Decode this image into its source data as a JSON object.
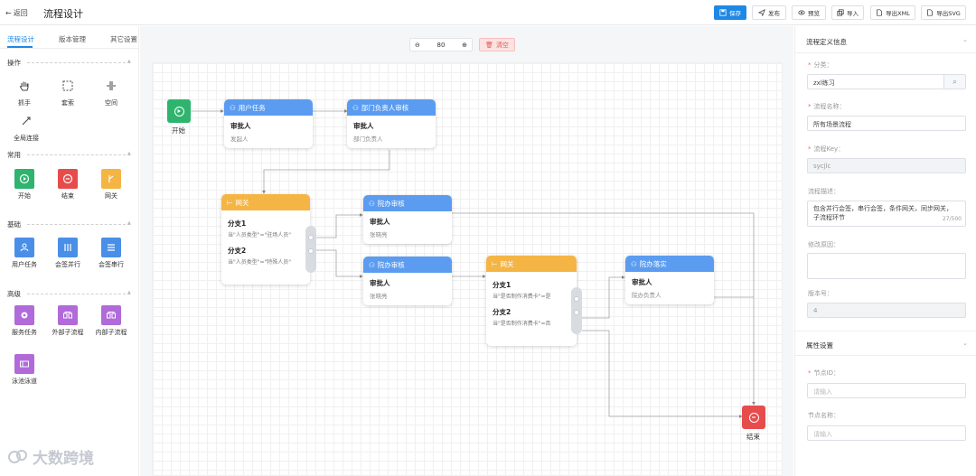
{
  "topbar": {
    "back_label": "返回",
    "title": "流程设计",
    "buttons": {
      "save": "保存",
      "publish": "发布",
      "preview": "预览",
      "import": "导入",
      "export_xml": "导出XML",
      "export_svg": "导出SVG"
    }
  },
  "leftpanel": {
    "tabs": [
      "流程设计",
      "版本管理",
      "其它设置"
    ],
    "sections": {
      "ops": "操作",
      "common": "常用",
      "basic": "基础",
      "advanced": "高级"
    },
    "tools": {
      "hand": "抓手",
      "lasso": "套索",
      "space": "空间",
      "global_connect": "全局连接",
      "start": "开始",
      "end": "结束",
      "gateway": "网关",
      "user_task": "用户任务",
      "parallel_sign": "会签并行",
      "serial_sign": "会签串行",
      "service_task": "服务任务",
      "external_subprocess": "外部子流程",
      "internal_subprocess": "内部子流程",
      "swimlane": "泳池泳道"
    },
    "colors": {
      "start": "#2fb46e",
      "end": "#e74c4c",
      "gateway": "#f5b544",
      "basic": "#4a8fe7",
      "advanced": "#b06ad9"
    }
  },
  "canvas": {
    "zoom": "80",
    "clear_label": "清空",
    "start_label": "开始",
    "end_label": "结束",
    "nodes": {
      "user_task": {
        "title": "用户任务",
        "l1": "审批人",
        "l2": "发起人"
      },
      "dept_head": {
        "title": "部门负责人审核",
        "l1": "审批人",
        "l2": "部门负责人"
      },
      "gateway1": {
        "title": "网关",
        "b1_t": "分支1",
        "b1_s": "当\"人员类型\"=\"驻场人员\"",
        "b2_t": "分支2",
        "b2_s": "当\"人员类型\"=\"特殊人员\""
      },
      "yuanban1": {
        "title": "院办审核",
        "l1": "审批人",
        "l2": "张晓亮"
      },
      "yuanban2": {
        "title": "院办审核",
        "l1": "审批人",
        "l2": "张晓亮"
      },
      "gateway2": {
        "title": "网关",
        "b1_t": "分支1",
        "b1_s": "当\"是否制作消费卡\"=是",
        "b2_t": "分支2",
        "b2_s": "当\"是否制作消费卡\"=否"
      },
      "yuanban_impl": {
        "title": "院办落实",
        "l1": "审批人",
        "l2": "院办负责人"
      }
    }
  },
  "rightpanel": {
    "section1_title": "流程定义信息",
    "category_label": "分类：",
    "category_value": "zxl练习",
    "name_label": "流程名称：",
    "name_value": "所有场景流程",
    "key_label": "流程Key：",
    "key_value": "sycjlc",
    "desc_label": "流程描述：",
    "desc_value_line1": "包含并行会签，串行会签，条件网关，同步网关，",
    "desc_value_line2": "子流程环节",
    "desc_count": "27/500",
    "reason_label": "修改原因：",
    "version_label": "版本号：",
    "version_value": "4",
    "section2_title": "属性设置",
    "node_id_label": "节点ID：",
    "node_id_placeholder": "请输入",
    "node_name_label": "节点名称：",
    "node_name_placeholder": "请输入"
  },
  "watermark": "大数跨境"
}
